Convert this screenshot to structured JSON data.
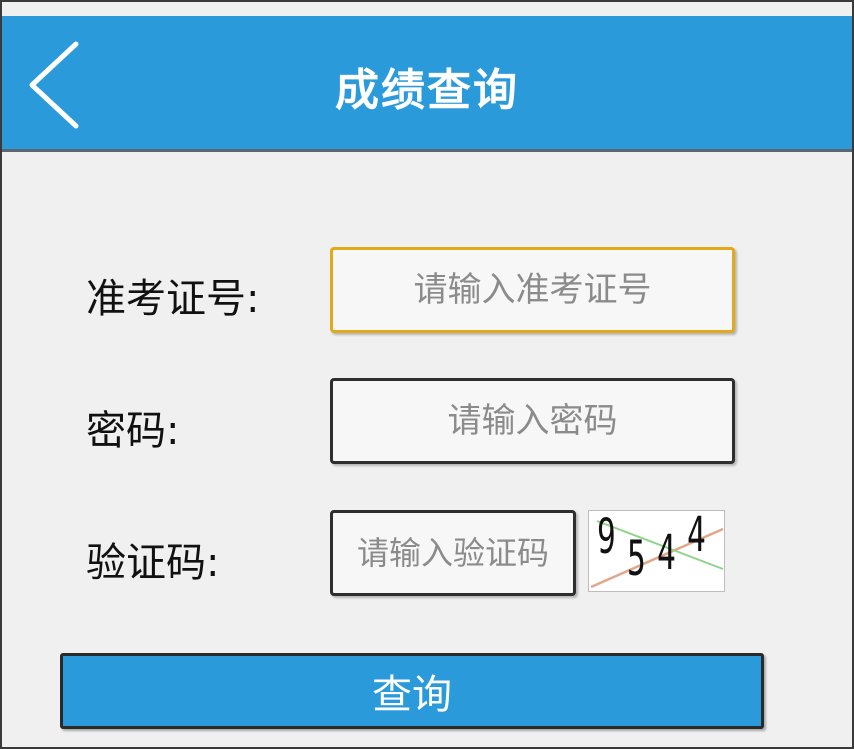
{
  "header": {
    "title": "成绩查询",
    "back_icon": "chevron-left-icon",
    "background_color": "#2b9ada"
  },
  "form": {
    "ticket": {
      "label": "准考证号:",
      "placeholder": "请输入准考证号",
      "value": "",
      "focused": true,
      "focus_color": "#e4a91a"
    },
    "password": {
      "label": "密码:",
      "placeholder": "请输入密码",
      "value": ""
    },
    "captcha": {
      "label": "验证码:",
      "placeholder": "请输入验证码",
      "value": "",
      "image_text": [
        "9",
        "5",
        "4",
        "4"
      ]
    },
    "submit_label": "查询"
  }
}
